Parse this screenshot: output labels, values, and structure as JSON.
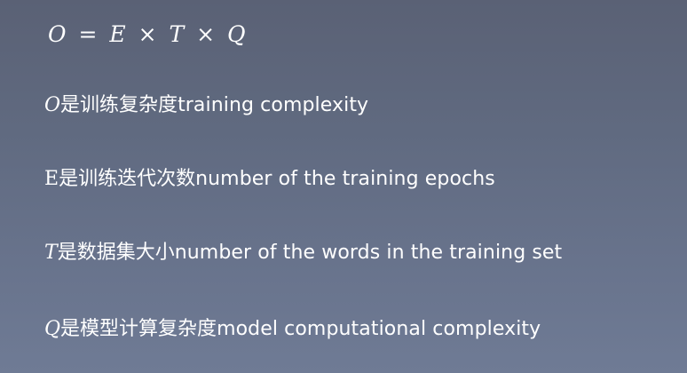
{
  "formula": {
    "lhs": "O",
    "eq": "=",
    "e": "E",
    "times1": "×",
    "t": "T",
    "times2": "×",
    "q": "Q"
  },
  "definitions": [
    {
      "symbol": "O",
      "zh": "是训练复杂度",
      "en": "training complexity"
    },
    {
      "symbol": "E",
      "zh": "是训练迭代次数",
      "en": "number of the training epochs"
    },
    {
      "symbol": "T",
      "zh": "是数据集大小",
      "en": "number of the words in the training set"
    },
    {
      "symbol": "Q",
      "zh": "是模型计算复杂度",
      "en": "model computational complexity"
    }
  ]
}
